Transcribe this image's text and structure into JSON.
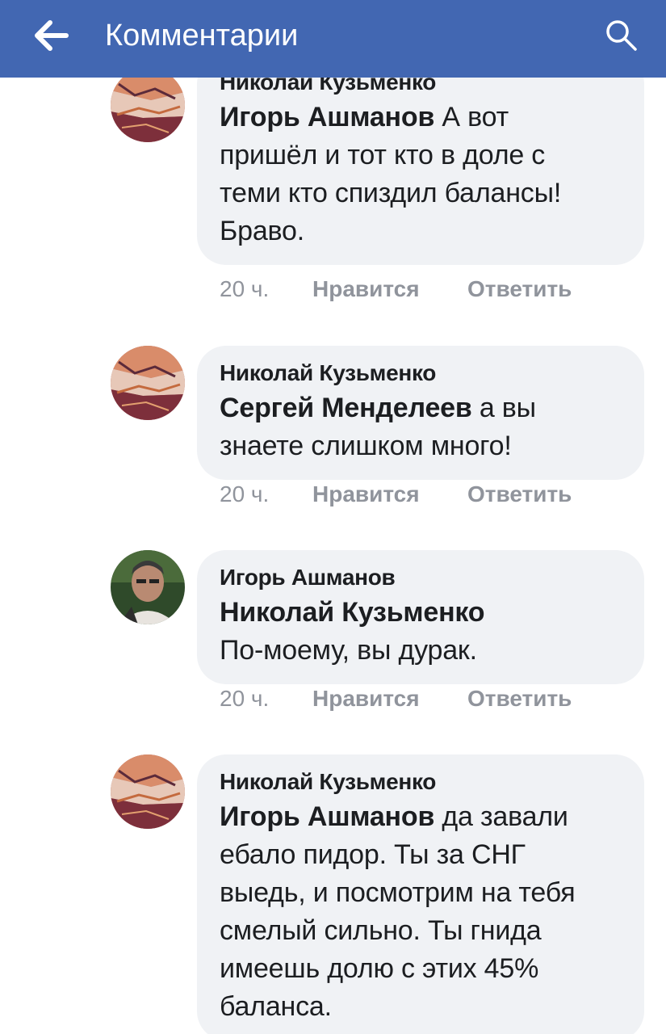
{
  "appbar": {
    "title": "Комментарии",
    "back_icon": "arrow-left-icon",
    "search_icon": "search-icon",
    "color": "#4267b2"
  },
  "comments": [
    {
      "author": "Николай Кузьменко",
      "mention": "Игорь Ашманов",
      "text_lines": [
        " А вот",
        "пришёл и тот кто в доле с",
        "теми кто спиздил балансы!",
        "Браво."
      ],
      "time": "20 ч.",
      "like": "Нравится",
      "reply": "Ответить"
    },
    {
      "author": "Николай Кузьменко",
      "mention": "Сергей Менделеев",
      "text_lines": [
        " а вы",
        "знаете слишком много!"
      ],
      "time": "20 ч.",
      "like": "Нравится",
      "reply": "Ответить"
    },
    {
      "author": "Игорь Ашманов",
      "mention": "Николай Кузьменко",
      "text_lines": [
        "",
        "По-моему, вы дурак."
      ],
      "time": "20 ч.",
      "like": "Нравится",
      "reply": "Ответить"
    },
    {
      "author": "Николай Кузьменко",
      "mention": "Игорь Ашманов",
      "text_lines": [
        " да завали",
        "ебало пидор. Ты за СНГ",
        "выедь, и посмотрим на тебя",
        "смелый сильно. Ты гнида",
        "имеешь долю с этих 45%",
        "баланса."
      ],
      "time": "",
      "like": "",
      "reply": ""
    }
  ]
}
